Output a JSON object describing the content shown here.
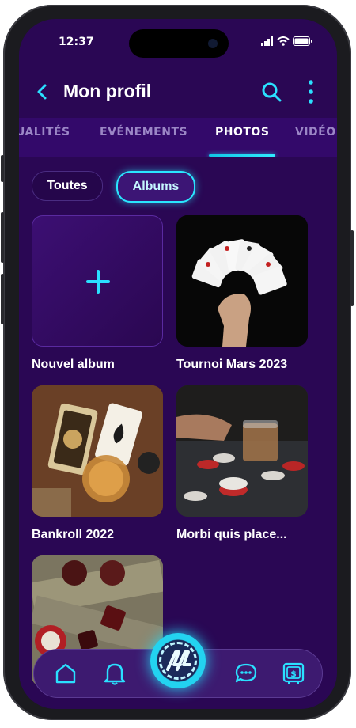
{
  "status_bar": {
    "time": "12:37"
  },
  "header": {
    "title": "Mon profil"
  },
  "tabs": [
    {
      "label": "UALITÉS"
    },
    {
      "label": "EVÉNEMENTS"
    },
    {
      "label": "PHOTOS",
      "active": true
    },
    {
      "label": "VIDÉO"
    }
  ],
  "filters": {
    "all": "Toutes",
    "albums": "Albums",
    "selected": "Albums"
  },
  "albums": [
    {
      "label": "Nouvel album",
      "type": "new"
    },
    {
      "label": "Tournoi Mars 2023"
    },
    {
      "label": "Bankroll 2022"
    },
    {
      "label": "Morbi quis place..."
    },
    {
      "label": ""
    }
  ],
  "colors": {
    "background": "#2a0754",
    "accent": "#2ae6ff",
    "tabbar": "#33096a"
  },
  "bottom_nav": [
    "home-icon",
    "bell-icon",
    "poker-chip-logo",
    "chat-icon",
    "wallet-icon"
  ]
}
